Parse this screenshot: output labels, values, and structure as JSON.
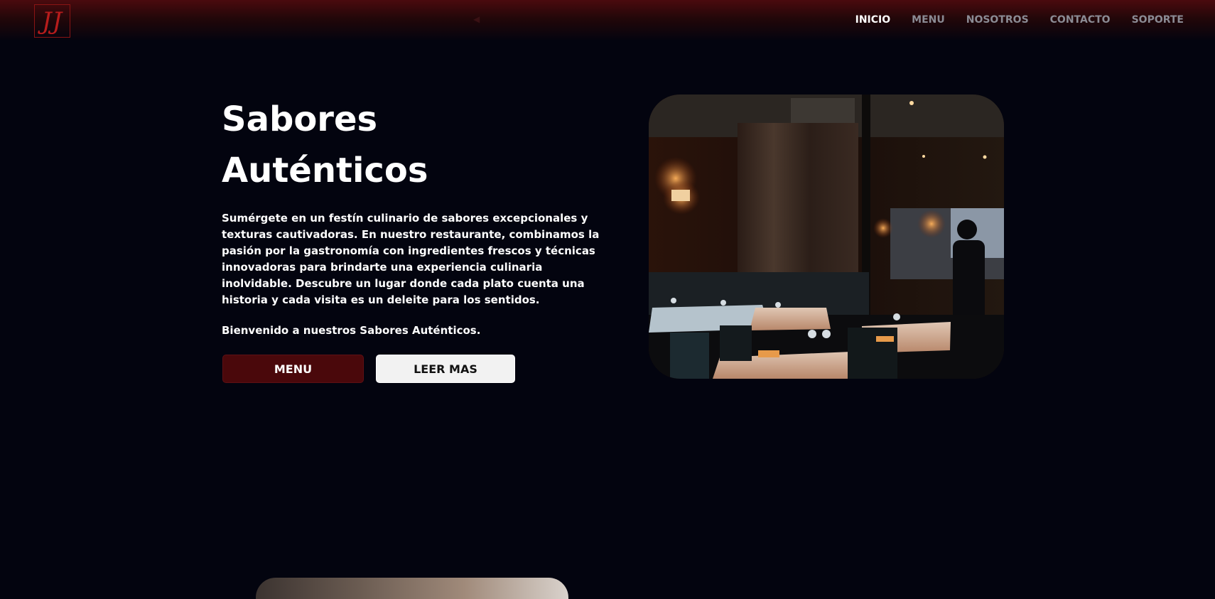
{
  "header": {
    "logo_text": "JJ",
    "nav": [
      {
        "label": "INICIO",
        "active": true
      },
      {
        "label": "MENU",
        "active": false
      },
      {
        "label": "NOSOTROS",
        "active": false
      },
      {
        "label": "CONTACTO",
        "active": false
      },
      {
        "label": "SOPORTE",
        "active": false
      }
    ]
  },
  "hero": {
    "title_line1": "Sabores",
    "title_line2": "Auténticos",
    "description": "Sumérgete en un festín culinario de sabores excepcionales y texturas cautivadoras. En nuestro restaurante, combinamos la pasión por la gastronomía con ingredientes frescos y técnicas innovadoras para brindarte una experiencia culinaria inolvidable. Descubre un lugar donde cada plato cuenta una historia y cada visita es un deleite para los sentidos.",
    "welcome": "Bienvenido a nuestros Sabores Auténticos.",
    "menu_button": "MENU",
    "read_more_button": "LEER MAS",
    "image_subject": "restaurant-interior-photo"
  },
  "colors": {
    "background": "#03040f",
    "header_accent": "#4a0a0e",
    "primary_button": "#4a080b",
    "secondary_button": "#f2f2f2",
    "text": "#ffffff",
    "nav_inactive": "#8b8b94"
  }
}
